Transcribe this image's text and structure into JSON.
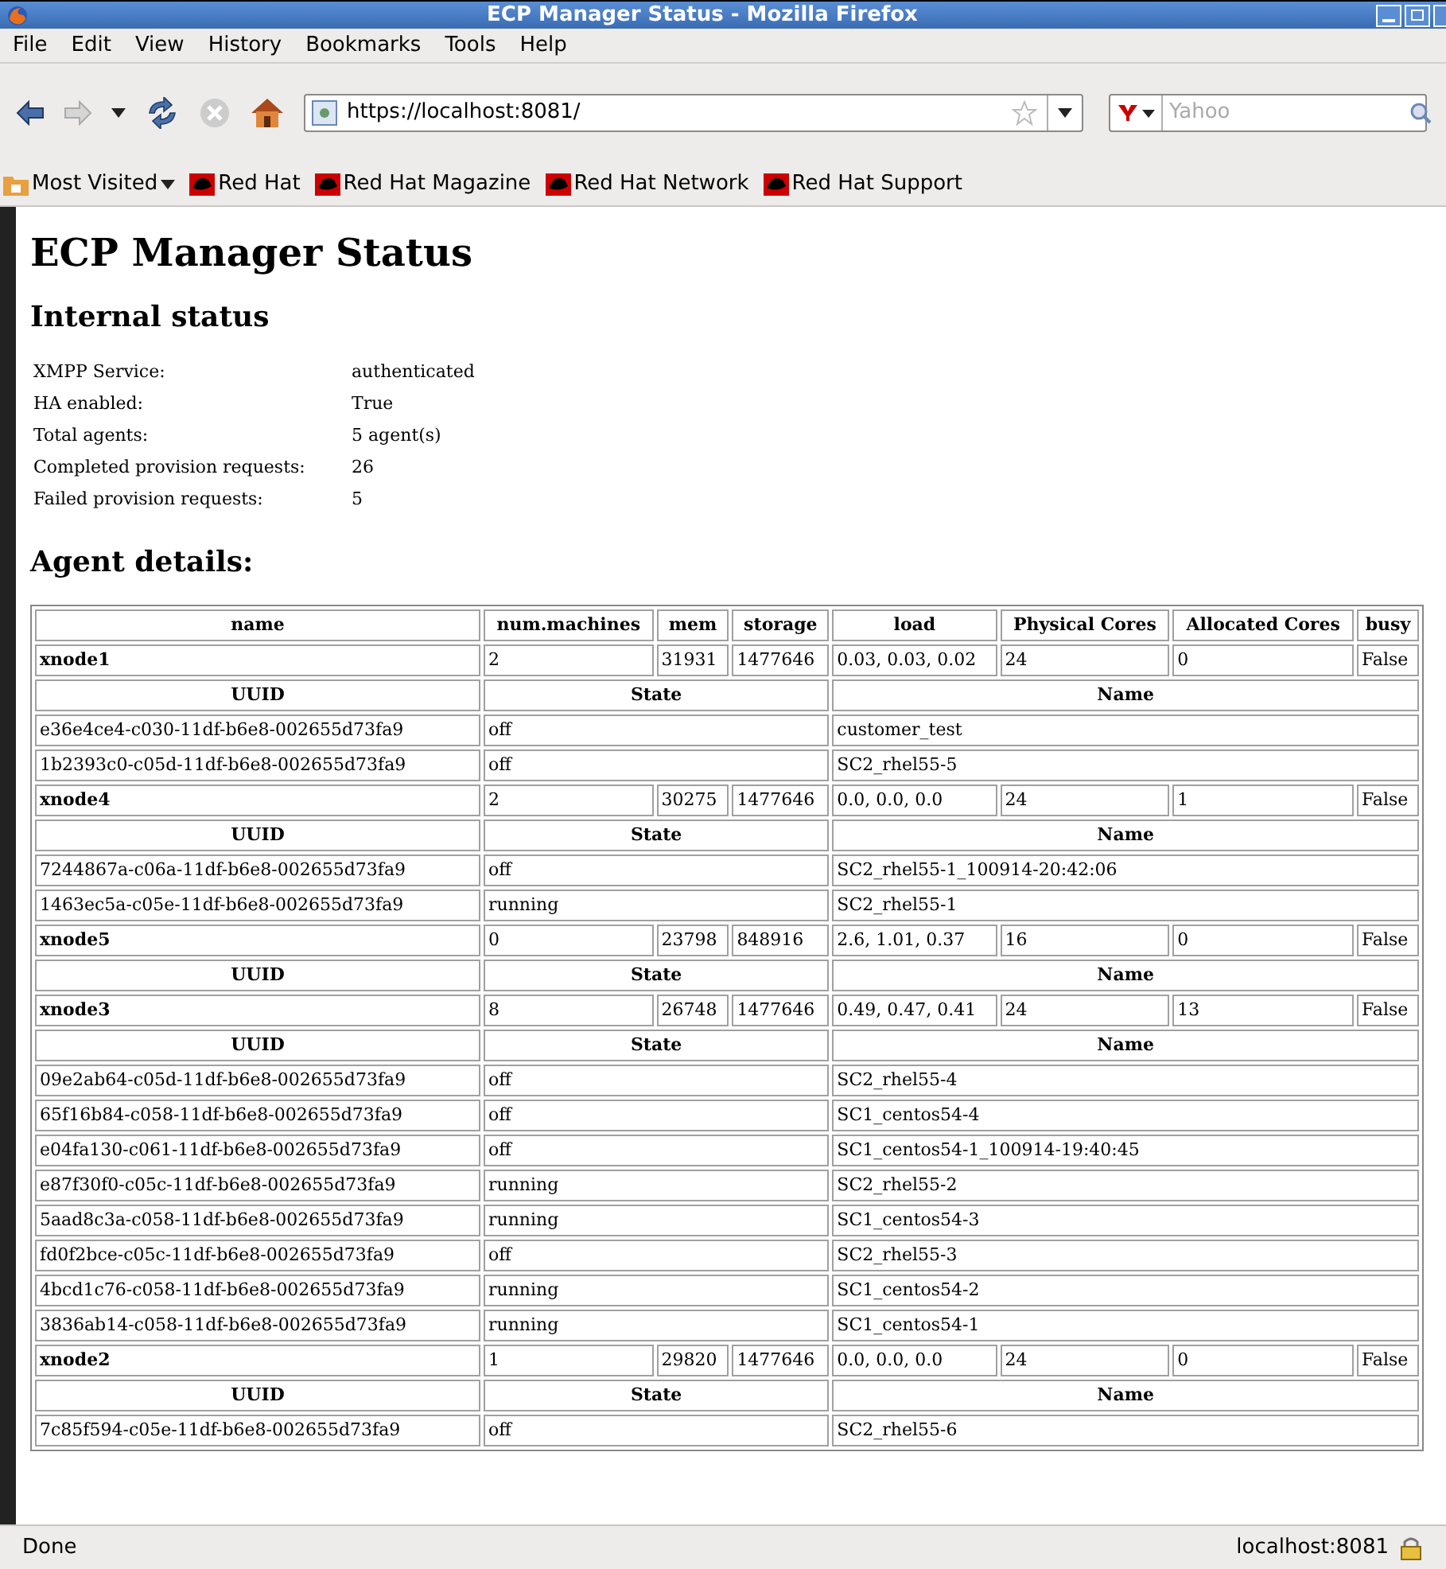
{
  "window": {
    "title": "ECP Manager Status - Mozilla Firefox"
  },
  "menu": [
    "File",
    "Edit",
    "View",
    "History",
    "Bookmarks",
    "Tools",
    "Help"
  ],
  "address_bar": {
    "value": "https://localhost:8081/"
  },
  "search": {
    "placeholder": "Yahoo"
  },
  "bookmarks": [
    {
      "label": "Most Visited",
      "kind": "folder"
    },
    {
      "label": "Red Hat",
      "kind": "link"
    },
    {
      "label": "Red Hat Magazine",
      "kind": "link"
    },
    {
      "label": "Red Hat Network",
      "kind": "link"
    },
    {
      "label": "Red Hat Support",
      "kind": "link"
    }
  ],
  "page": {
    "title": "ECP Manager Status",
    "internal_heading": "Internal status",
    "internal_status": [
      {
        "label": "XMPP Service:",
        "value": "authenticated"
      },
      {
        "label": "HA enabled:",
        "value": "True"
      },
      {
        "label": "Total agents:",
        "value": "5 agent(s)"
      },
      {
        "label": "Completed provision requests:",
        "value": "26"
      },
      {
        "label": "Failed provision requests:",
        "value": "5"
      }
    ],
    "agents_heading": "Agent details:",
    "columns": [
      "name",
      "num.machines",
      "mem",
      "storage",
      "load",
      "Physical Cores",
      "Allocated Cores",
      "busy"
    ],
    "agents": [
      {
        "name": "xnode1",
        "num_machines": "2",
        "mem": "31931",
        "storage": "1477646",
        "load": "0.03, 0.03, 0.02",
        "physical_cores": "24",
        "allocated_cores": "0",
        "busy": "False",
        "vm_columns": [
          "UUID",
          "State",
          "Name"
        ],
        "vms": [
          {
            "uuid": "e36e4ce4-c030-11df-b6e8-002655d73fa9",
            "state": "off",
            "name": "customer_test"
          },
          {
            "uuid": "1b2393c0-c05d-11df-b6e8-002655d73fa9",
            "state": "off",
            "name": "SC2_rhel55-5"
          }
        ]
      },
      {
        "name": "xnode4",
        "num_machines": "2",
        "mem": "30275",
        "storage": "1477646",
        "load": "0.0, 0.0, 0.0",
        "physical_cores": "24",
        "allocated_cores": "1",
        "busy": "False",
        "vm_columns": [
          "UUID",
          "State",
          "Name"
        ],
        "vms": [
          {
            "uuid": "7244867a-c06a-11df-b6e8-002655d73fa9",
            "state": "off",
            "name": "SC2_rhel55-1_100914-20:42:06"
          },
          {
            "uuid": "1463ec5a-c05e-11df-b6e8-002655d73fa9",
            "state": "running",
            "name": "SC2_rhel55-1"
          }
        ]
      },
      {
        "name": "xnode5",
        "num_machines": "0",
        "mem": "23798",
        "storage": "848916",
        "load": "2.6, 1.01, 0.37",
        "physical_cores": "16",
        "allocated_cores": "0",
        "busy": "False",
        "vm_columns": [
          "UUID",
          "State",
          "Name"
        ]
      },
      {
        "name": "xnode3",
        "num_machines": "8",
        "mem": "26748",
        "storage": "1477646",
        "load": "0.49, 0.47, 0.41",
        "physical_cores": "24",
        "allocated_cores": "13",
        "busy": "False",
        "vm_columns": [
          "UUID",
          "State",
          "Name"
        ],
        "vms": [
          {
            "uuid": "09e2ab64-c05d-11df-b6e8-002655d73fa9",
            "state": "off",
            "name": "SC2_rhel55-4"
          },
          {
            "uuid": "65f16b84-c058-11df-b6e8-002655d73fa9",
            "state": "off",
            "name": "SC1_centos54-4"
          },
          {
            "uuid": "e04fa130-c061-11df-b6e8-002655d73fa9",
            "state": "off",
            "name": "SC1_centos54-1_100914-19:40:45"
          },
          {
            "uuid": "e87f30f0-c05c-11df-b6e8-002655d73fa9",
            "state": "running",
            "name": "SC2_rhel55-2"
          },
          {
            "uuid": "5aad8c3a-c058-11df-b6e8-002655d73fa9",
            "state": "running",
            "name": "SC1_centos54-3"
          },
          {
            "uuid": "fd0f2bce-c05c-11df-b6e8-002655d73fa9",
            "state": "off",
            "name": "SC2_rhel55-3"
          },
          {
            "uuid": "4bcd1c76-c058-11df-b6e8-002655d73fa9",
            "state": "running",
            "name": "SC1_centos54-2"
          },
          {
            "uuid": "3836ab14-c058-11df-b6e8-002655d73fa9",
            "state": "running",
            "name": "SC1_centos54-1"
          }
        ]
      },
      {
        "name": "xnode2",
        "num_machines": "1",
        "mem": "29820",
        "storage": "1477646",
        "load": "0.0, 0.0, 0.0",
        "physical_cores": "24",
        "allocated_cores": "0",
        "busy": "False",
        "vm_columns": [
          "UUID",
          "State",
          "Name"
        ],
        "vms": [
          {
            "uuid": "7c85f594-c05e-11df-b6e8-002655d73fa9",
            "state": "off",
            "name": "SC2_rhel55-6"
          }
        ]
      }
    ]
  },
  "status_bar": {
    "text": "Done",
    "host": "localhost:8081"
  }
}
